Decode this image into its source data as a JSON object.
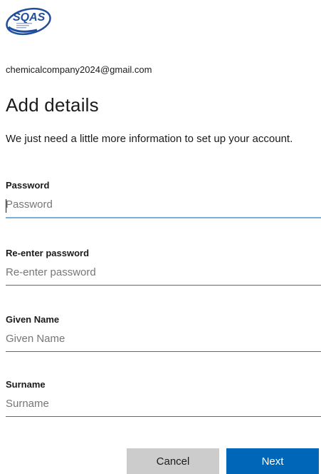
{
  "logo": {
    "text": "SQAS"
  },
  "account": {
    "email": "chemicalcompany2024@gmail.com"
  },
  "page": {
    "title": "Add details",
    "description": "We just need a little more information to set up your account."
  },
  "fields": {
    "password": {
      "label": "Password",
      "placeholder": "Password",
      "value": ""
    },
    "reenter_password": {
      "label": "Re-enter password",
      "placeholder": "Re-enter password",
      "value": ""
    },
    "given_name": {
      "label": "Given Name",
      "placeholder": "Given Name",
      "value": ""
    },
    "surname": {
      "label": "Surname",
      "placeholder": "Surname",
      "value": ""
    }
  },
  "buttons": {
    "cancel": "Cancel",
    "next": "Next"
  },
  "colors": {
    "accent": "#0067b8",
    "focus_underline": "#7ab0d8",
    "cancel_bg": "#cccccc",
    "logo_blue": "#1f4e9c"
  }
}
